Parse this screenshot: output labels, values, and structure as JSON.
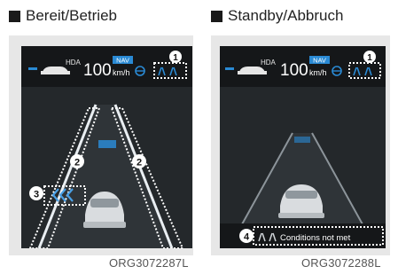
{
  "panels": [
    {
      "title": "Bereit/Betrieb",
      "hda_label": "HDA",
      "speed": "100",
      "speed_unit": "km/h",
      "nav_badge": "NAV",
      "callouts": [
        "1",
        "2",
        "2",
        "3"
      ],
      "code": "ORG3072287L",
      "lane_line_color": "#e9eef2",
      "hda_color": "#2a8ad4"
    },
    {
      "title": "Standby/Abbruch",
      "hda_label": "HDA",
      "speed": "100",
      "speed_unit": "km/h",
      "nav_badge": "NAV",
      "callouts": [
        "1",
        "4"
      ],
      "message": "Conditions not met",
      "code": "ORG3072288L",
      "lane_line_color": "#8c949a",
      "hda_color": "#2a8ad4"
    }
  ],
  "icons": [
    "steering-wheel-icon",
    "lane-assist-icon",
    "car-icon"
  ]
}
